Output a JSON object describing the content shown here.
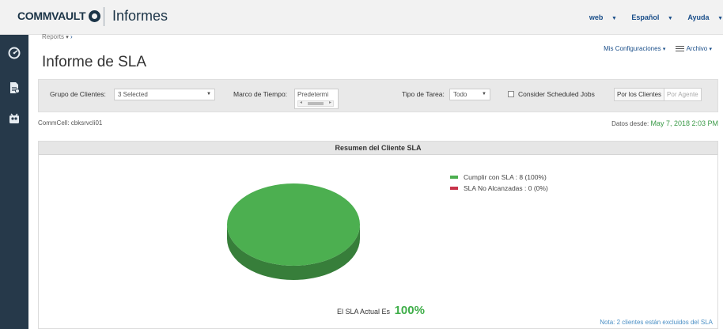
{
  "header": {
    "brand": "COMMVAULT",
    "app_title": "Informes",
    "user": "web",
    "language": "Español",
    "help": "Ayuda"
  },
  "nav": {
    "icons": [
      "dashboard-icon",
      "reports-icon",
      "users-icon"
    ]
  },
  "breadcrumb": {
    "root": "Reports"
  },
  "page": {
    "title": "Informe de SLA"
  },
  "top_actions": {
    "configs": "Mis Configuraciones",
    "file": "Archivo"
  },
  "filters": {
    "client_group_label": "Grupo de Clientes:",
    "client_group_value": "3 Selected",
    "time_frame_label": "Marco de Tiempo:",
    "time_frame_value": "Predetermi",
    "job_type_label": "Tipo de Tarea:",
    "job_type_value": "Todo",
    "scheduled_jobs_label": "Consider Scheduled Jobs",
    "view_by_clients": "Por los Clientes",
    "view_by_agent": "Por Agente"
  },
  "commcell": "CommCell: cbksrvcli01",
  "data_since": {
    "label": "Datos desde:",
    "date": "May 7, 2018 2:03 PM"
  },
  "panel": {
    "title": "Resumen del Cliente SLA",
    "sla_text": "El SLA Actual Es",
    "sla_value": "100%",
    "note": "Nota: 2 clientes están excluidos del SLA"
  },
  "chart_data": {
    "type": "pie",
    "title": "Resumen del Cliente SLA",
    "series": [
      {
        "name": "Cumplir con SLA : 8 (100%)",
        "value": 8,
        "color": "#4caf50"
      },
      {
        "name": "SLA No Alcanzadas : 0 (0%)",
        "value": 0,
        "color": "#c8334a"
      }
    ],
    "legend_position": "top-right"
  }
}
